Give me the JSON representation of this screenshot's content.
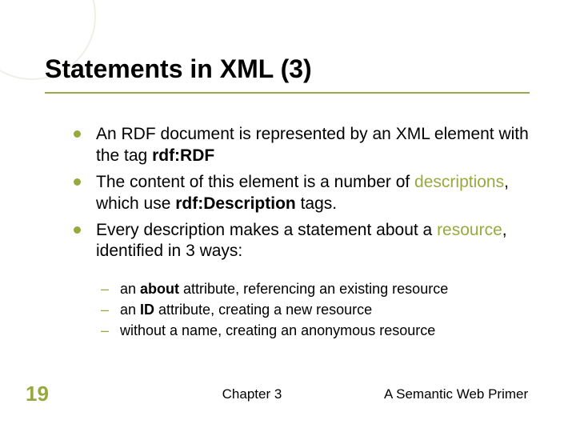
{
  "title": "Statements in XML (3)",
  "bullets": [
    {
      "pre": "An RDF document is represented by an XML element with the tag ",
      "bold": "rdf:RDF",
      "post": ""
    },
    {
      "pre": "The content of this element is a number of ",
      "hl": "descriptions",
      "mid": ", which use ",
      "bold": "rdf:Description",
      "post": " tags."
    },
    {
      "pre": "Every description makes a statement about a ",
      "hl": "resource",
      "post": ", identified in 3 ways:"
    }
  ],
  "sub_bullets": [
    {
      "pre": "an ",
      "bold": "about",
      "post": " attribute, referencing an existing resource"
    },
    {
      "pre": "an ",
      "bold": "ID",
      "post": " attribute, creating a new resource"
    },
    {
      "pre": "without a name, creating an anonymous resource",
      "bold": "",
      "post": ""
    }
  ],
  "footer": {
    "slide_number": "19",
    "center": "Chapter 3",
    "right": "A Semantic Web Primer"
  }
}
